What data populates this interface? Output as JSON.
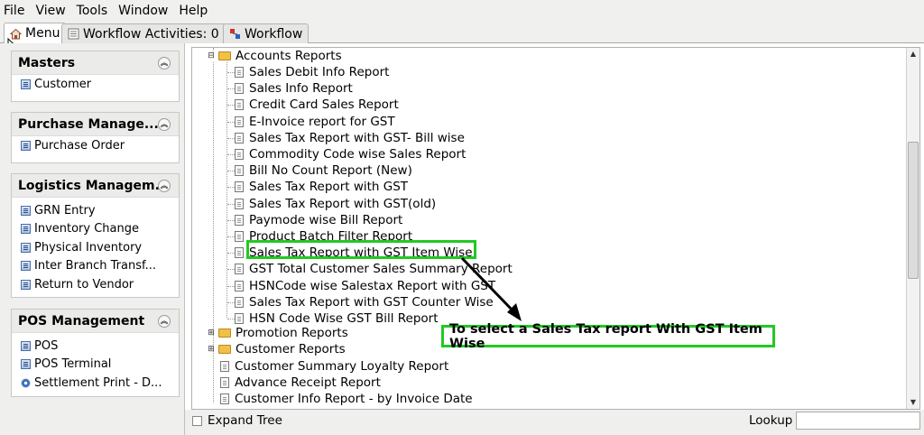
{
  "menubar": {
    "items": [
      "File",
      "View",
      "Tools",
      "Window",
      "Help"
    ]
  },
  "tabs": [
    {
      "label": "Menu",
      "icon": "home-icon"
    },
    {
      "label": "Workflow Activities: 0",
      "icon": "workflow-activities-icon"
    },
    {
      "label": "Workflow",
      "icon": "workflow-icon"
    }
  ],
  "sidebar": {
    "sections": [
      {
        "title": "Masters",
        "items": [
          "Customer"
        ]
      },
      {
        "title": "Purchase Manage...",
        "items": [
          "Purchase Order"
        ]
      },
      {
        "title": "Logistics Managem...",
        "items": [
          "GRN Entry",
          "Inventory Change",
          "Physical Inventory",
          "Inter Branch Transf...",
          "Return to Vendor"
        ]
      },
      {
        "title": "POS Management",
        "items": [
          "POS",
          "POS Terminal",
          "Settlement Print - D..."
        ]
      }
    ]
  },
  "tree": {
    "accounts_folder": "Accounts Reports",
    "accounts_items": [
      "Sales Debit Info Report",
      "Sales Info Report",
      "Credit Card Sales Report",
      "E-Invoice report for GST",
      "Sales Tax Report with GST- Bill wise",
      "Commodity Code wise Sales Report",
      "Bill No Count Report (New)",
      "Sales Tax Report with GST",
      "Sales Tax Report with GST(old)",
      "Paymode wise Bill Report",
      "Product Batch Filter Report",
      "Sales Tax Report with GST Item Wise",
      "GST Total Customer Sales Summary Report",
      "HSNCode wise Salestax Report with GST",
      "Sales Tax Report with GST Counter Wise",
      "HSN Code Wise GST Bill Report"
    ],
    "folders": [
      "Promotion Reports",
      "Customer Reports"
    ],
    "root_items": [
      "Customer Summary Loyalty Report",
      "Advance Receipt Report",
      "Customer Info Report - by Invoice Date"
    ]
  },
  "annotation": {
    "callout_text": "To select a Sales Tax report With GST Item Wise",
    "highlight_color": "#22c922"
  },
  "bottombar": {
    "expand_tree_label": "Expand Tree",
    "lookup_label": "Lookup",
    "lookup_value": ""
  }
}
